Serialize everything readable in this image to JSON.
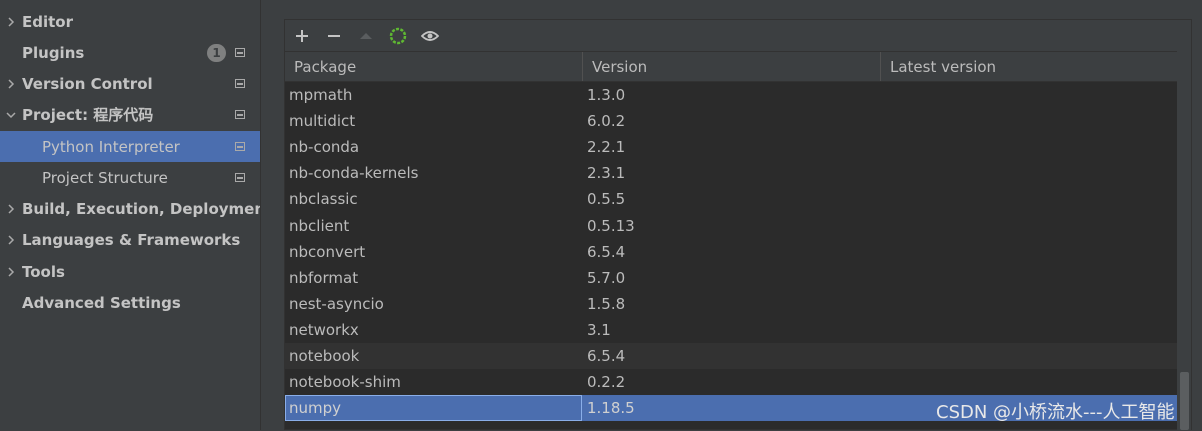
{
  "sidebar": {
    "items": [
      {
        "label": "Editor",
        "expandable": true,
        "expanded": false
      },
      {
        "label": "Plugins",
        "expandable": false,
        "badge": "1"
      },
      {
        "label": "Version Control",
        "expandable": true,
        "expanded": false
      },
      {
        "label": "Project: 程序代码",
        "expandable": true,
        "expanded": true
      },
      {
        "label": "Python Interpreter",
        "child": true,
        "selected": true
      },
      {
        "label": "Project Structure",
        "child": true
      },
      {
        "label": "Build, Execution, Deployment",
        "expandable": true,
        "expanded": false
      },
      {
        "label": "Languages & Frameworks",
        "expandable": true,
        "expanded": false
      },
      {
        "label": "Tools",
        "expandable": true,
        "expanded": false
      },
      {
        "label": "Advanced Settings",
        "expandable": false
      }
    ]
  },
  "toolbar": {
    "buttons": [
      "add-icon",
      "remove-icon",
      "upgrade-icon",
      "loading-spinner-icon",
      "show-early-releases-icon"
    ]
  },
  "table": {
    "columns": [
      "Package",
      "Version",
      "Latest version"
    ],
    "rows": [
      {
        "package": "mpmath",
        "version": "1.3.0",
        "latest": ""
      },
      {
        "package": "multidict",
        "version": "6.0.2",
        "latest": ""
      },
      {
        "package": "nb-conda",
        "version": "2.2.1",
        "latest": ""
      },
      {
        "package": "nb-conda-kernels",
        "version": "2.3.1",
        "latest": ""
      },
      {
        "package": "nbclassic",
        "version": "0.5.5",
        "latest": ""
      },
      {
        "package": "nbclient",
        "version": "0.5.13",
        "latest": ""
      },
      {
        "package": "nbconvert",
        "version": "6.5.4",
        "latest": ""
      },
      {
        "package": "nbformat",
        "version": "5.7.0",
        "latest": ""
      },
      {
        "package": "nest-asyncio",
        "version": "1.5.8",
        "latest": ""
      },
      {
        "package": "networkx",
        "version": "3.1",
        "latest": ""
      },
      {
        "package": "notebook",
        "version": "6.5.4",
        "latest": "",
        "hover": true
      },
      {
        "package": "notebook-shim",
        "version": "0.2.2",
        "latest": ""
      },
      {
        "package": "numpy",
        "version": "1.18.5",
        "latest": "",
        "selected": true
      }
    ]
  },
  "watermark": "CSDN @小桥流水---人工智能",
  "colors": {
    "background": "#3c3f41",
    "table_bg": "#2b2b2b",
    "selection": "#4b6eaf",
    "text": "#bbbbbb",
    "spinner": "#5fb832"
  }
}
